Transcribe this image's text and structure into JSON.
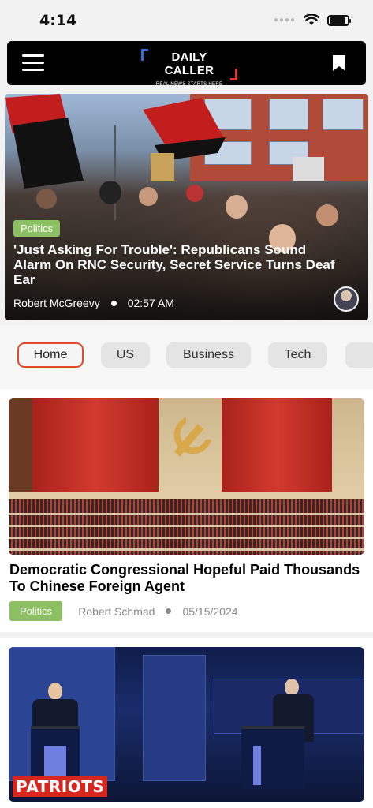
{
  "status_bar": {
    "time": "4:14",
    "icons": [
      "signal-dots-icon",
      "wifi-icon",
      "battery-icon"
    ]
  },
  "header": {
    "menu_icon": "hamburger-menu-icon",
    "logo_text": "DAILY CALLER",
    "logo_tagline": "REAL NEWS STARTS HERE",
    "bookmark_icon": "bookmark-icon"
  },
  "hero": {
    "category": "Politics",
    "title": "'Just Asking For Trouble': Republicans Sound Alarm On RNC Security, Secret Service Turns Deaf Ear",
    "author": "Robert McGreevy",
    "time": "02:57 AM"
  },
  "tabs": [
    {
      "label": "Home",
      "active": true
    },
    {
      "label": "US",
      "active": false
    },
    {
      "label": "Business",
      "active": false
    },
    {
      "label": "Tech",
      "active": false
    }
  ],
  "articles": [
    {
      "title": "Democratic Congressional Hopeful Paid Thousands To Chinese Foreign Agent",
      "category": "Politics",
      "author": "Robert Schmad",
      "date": "05/15/2024"
    },
    {
      "image_label": "PATRIOTS"
    }
  ],
  "colors": {
    "accent_red": "#e2492d",
    "badge_green": "#8cc063",
    "header_bg": "#000000"
  }
}
